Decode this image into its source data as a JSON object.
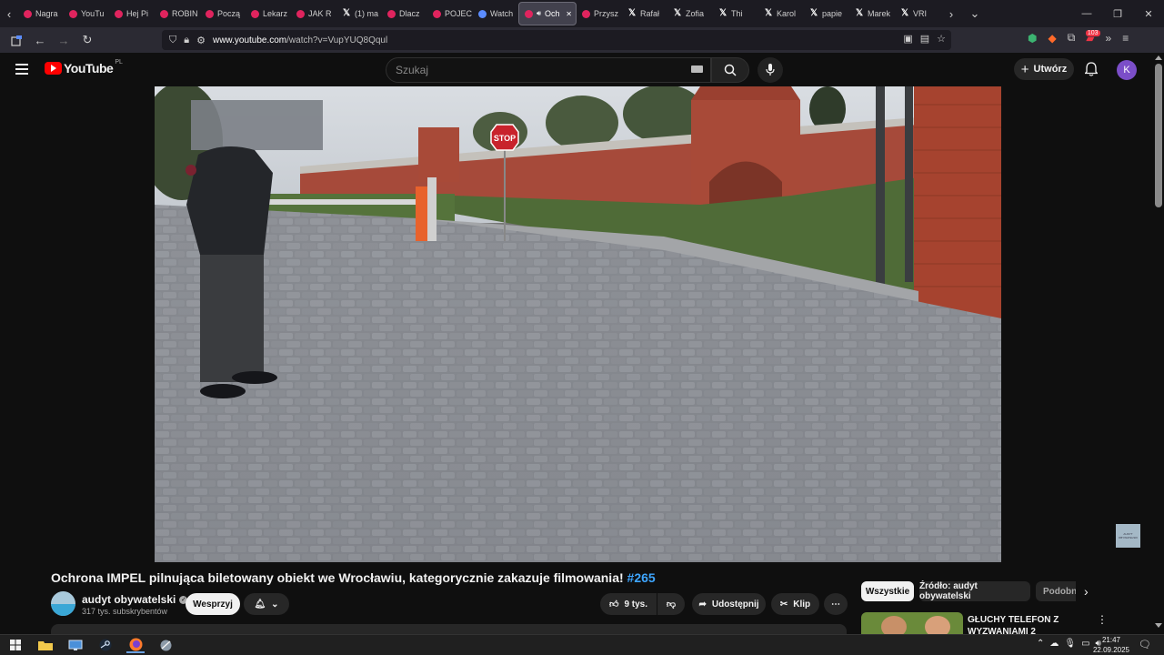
{
  "browser": {
    "tabs": [
      {
        "label": "Nagra",
        "icon": "youtube-icon"
      },
      {
        "label": "YouTu",
        "icon": "youtube-icon"
      },
      {
        "label": "Hej Pi",
        "icon": "youtube-icon"
      },
      {
        "label": "ROBIN",
        "icon": "youtube-icon"
      },
      {
        "label": "Począ",
        "icon": "youtube-icon"
      },
      {
        "label": "Lekarz",
        "icon": "youtube-icon"
      },
      {
        "label": "JAK R",
        "icon": "youtube-icon"
      },
      {
        "label": "(1) ma",
        "icon": "x-icon"
      },
      {
        "label": "Dlacz",
        "icon": "youtube-icon"
      },
      {
        "label": "POJEC",
        "icon": "youtube-icon"
      },
      {
        "label": "Watch",
        "icon": "multi-icon"
      },
      {
        "label": "Och",
        "icon": "youtube-icon",
        "active": true
      },
      {
        "label": "Przysz",
        "icon": "youtube-icon"
      },
      {
        "label": "Rafał",
        "icon": "x-icon"
      },
      {
        "label": "Zofia",
        "icon": "x-icon"
      },
      {
        "label": "Thi",
        "icon": "x-icon"
      },
      {
        "label": "Karol",
        "icon": "x-icon"
      },
      {
        "label": "papie",
        "icon": "x-icon"
      },
      {
        "label": "Marek",
        "icon": "x-icon"
      },
      {
        "label": "VRI",
        "icon": "x-icon"
      }
    ],
    "url_host": "www.youtube.com",
    "url_path": "/watch?v=VupYUQ8Qqul",
    "extension_badge": "103",
    "accent_color": "#42414d"
  },
  "youtube": {
    "logo_text": "YouTube",
    "region": "PL",
    "search_placeholder": "Szukaj",
    "create_label": "Utwórz",
    "avatar_letter": "K",
    "video": {
      "title": "Ochrona IMPEL pilnująca biletowany obiekt we Wrocławiu, kategorycznie zakazuje filmowania!",
      "hashtag": "#265",
      "sign_text": "STOP",
      "watermark": "AUDYT OBYWATELSKI"
    },
    "channel": {
      "name": "audyt obywatelski",
      "subscribers": "317 tys. subskrybentów"
    },
    "actions": {
      "support": "Wesprzyj",
      "likes": "9 tys.",
      "share": "Udostępnij",
      "clip": "Klip"
    },
    "chips": [
      "Wszystkie",
      "Źródło: audyt obywatelski",
      "Podobne"
    ],
    "recommended": {
      "title_line1": "GŁUCHY TELEFON Z",
      "title_line2": "WYZWANIAMI 2"
    }
  },
  "taskbar": {
    "time": "21:47",
    "date": "22.09.2025"
  }
}
